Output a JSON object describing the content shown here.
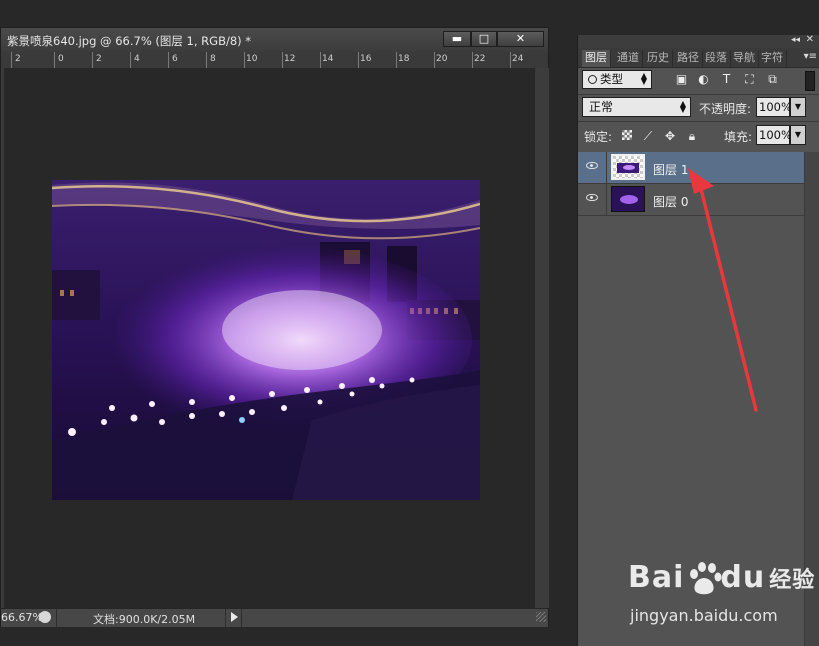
{
  "document": {
    "title": "紫景喷泉640.jpg @ 66.7% (图层 1, RGB/8) *",
    "window_buttons": {
      "minimize": "▬",
      "maximize": "□",
      "close": "✕"
    },
    "ruler_ticks": [
      "2",
      "0",
      "2",
      "4",
      "6",
      "8",
      "10",
      "12",
      "14",
      "16",
      "18",
      "20",
      "22",
      "24"
    ],
    "status": {
      "zoom": "66.67%",
      "doc_info": "文档:900.0K/2.05M"
    }
  },
  "panel": {
    "collapse": "◂◂",
    "close": "✕",
    "menu": "▾≡",
    "tabs": [
      "图层",
      "通道",
      "历史",
      "路径",
      "段落",
      "导航",
      "字符"
    ],
    "active_tab": "图层",
    "filter": {
      "label": "类型",
      "icons": [
        "image-filter-icon",
        "adjustment-filter-icon",
        "type-filter-icon",
        "shape-filter-icon",
        "smart-object-filter-icon"
      ]
    },
    "blend_mode": "正常",
    "opacity_label": "不透明度:",
    "opacity_value": "100%",
    "lock_label": "锁定:",
    "fill_label": "填充:",
    "fill_value": "100%",
    "layers": [
      {
        "name": "图层 1",
        "selected": true,
        "visible": true
      },
      {
        "name": "图层 0",
        "selected": false,
        "visible": true
      }
    ]
  },
  "watermark": {
    "brand": "Bai",
    "brand2": "du",
    "brand_cn": "经验",
    "url": "jingyan.baidu.com"
  },
  "colors": {
    "selection": "#5a6f8a",
    "annotation_arrow": "#e8383d",
    "photo_glow": "#b050ff"
  }
}
